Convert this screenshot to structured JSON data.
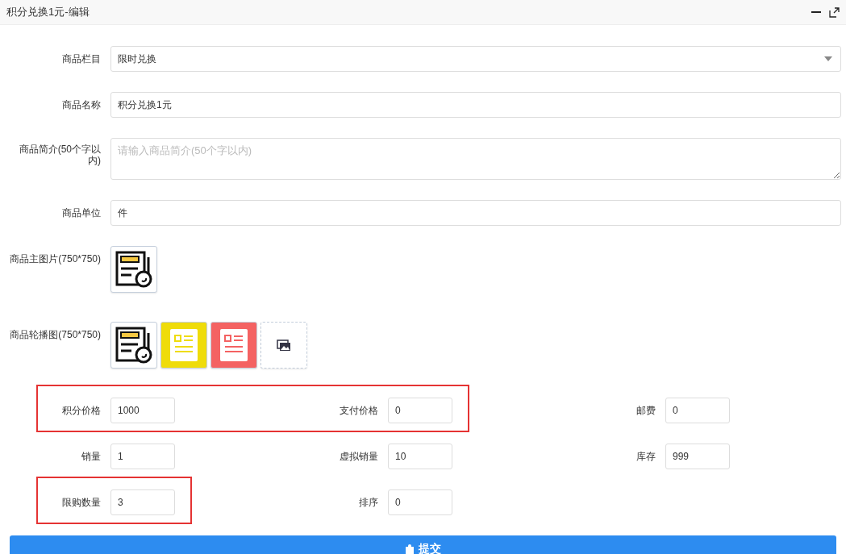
{
  "window": {
    "title": "积分兑换1元-编辑"
  },
  "fields": [
    {
      "kind": "select",
      "label": "商品栏目",
      "value": "限时兑换"
    },
    {
      "kind": "text",
      "label": "商品名称",
      "value": "积分兑换1元"
    },
    {
      "kind": "textarea",
      "label": "商品简介(50个字以内)",
      "placeholder": "请输入商品简介(50个字以内)"
    },
    {
      "kind": "text",
      "label": "商品单位",
      "value": "件"
    },
    {
      "kind": "images",
      "label": "商品主图片(750*750)",
      "images": [
        {
          "kind": "doc-clock"
        }
      ]
    },
    {
      "kind": "images",
      "label": "商品轮播图(750*750)",
      "images": [
        {
          "kind": "doc-clock"
        },
        {
          "kind": "doc-yellow"
        },
        {
          "kind": "doc-red"
        },
        {
          "kind": "add"
        }
      ]
    }
  ],
  "grid_rows": [
    [
      {
        "label": "积分价格",
        "value": "1000",
        "highlighted": true
      },
      {
        "label": "支付价格",
        "value": "0",
        "highlighted": true
      },
      {
        "label": "邮费",
        "value": "0",
        "highlighted": false
      }
    ],
    [
      {
        "label": "销量",
        "value": "1",
        "highlighted": false
      },
      {
        "label": "虚拟销量",
        "value": "10",
        "highlighted": false
      },
      {
        "label": "库存",
        "value": "999",
        "highlighted": false
      }
    ],
    [
      {
        "label": "限购数量",
        "value": "3",
        "highlighted": true
      },
      {
        "label": "排序",
        "value": "0",
        "highlighted": false
      }
    ]
  ],
  "submit": {
    "label": "提交"
  }
}
